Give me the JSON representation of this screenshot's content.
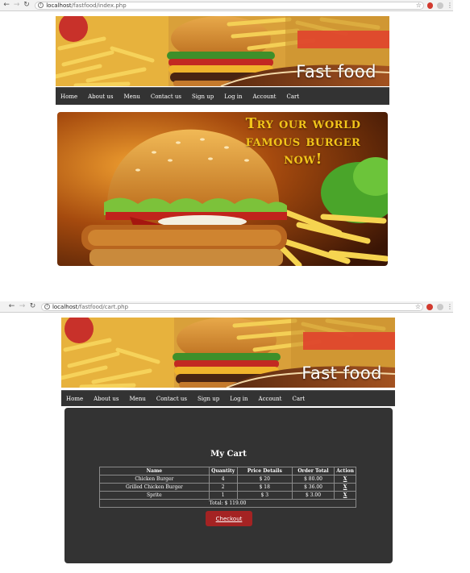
{
  "screens": {
    "index": {
      "url_host": "localhost",
      "url_path": "/fastfood/index.php",
      "brand": "Fast food",
      "promo_headline": [
        "Try our world",
        "famous burger",
        "now!"
      ]
    },
    "cart": {
      "url_host": "localhost",
      "url_path": "/fastfood/cart.php",
      "brand": "Fast food",
      "title": "My Cart",
      "columns": [
        "Name",
        "Quantity",
        "Price Details",
        "Order Total",
        "Action"
      ],
      "items": [
        {
          "name": "Chicken Burger",
          "quantity": "4",
          "price": "$ 20",
          "total": "$ 80.00",
          "action": "X"
        },
        {
          "name": "Grilled Chicken Burger",
          "quantity": "2",
          "price": "$ 18",
          "total": "$ 36.00",
          "action": "X"
        },
        {
          "name": "Sprite",
          "quantity": "1",
          "price": "$ 3",
          "total": "$ 3.00",
          "action": "X"
        }
      ],
      "total_label": "Total: $ 119.00",
      "checkout_label": "Checkout"
    }
  },
  "nav": [
    "Home",
    "About us",
    "Menu",
    "Contact us",
    "Sign up",
    "Log in",
    "Account",
    "Cart"
  ],
  "icons": {
    "back": "arrow-left-icon",
    "forward": "arrow-right-icon",
    "reload": "reload-icon",
    "info": "info-icon",
    "bookmark": "star-icon",
    "extension": "adblock-icon",
    "profile": "profile-icon",
    "menu": "kebab-menu-icon"
  },
  "colors": {
    "navbar": "#333333",
    "panel": "#333333",
    "checkout": "#a42323",
    "headline": "#f2c51a"
  }
}
